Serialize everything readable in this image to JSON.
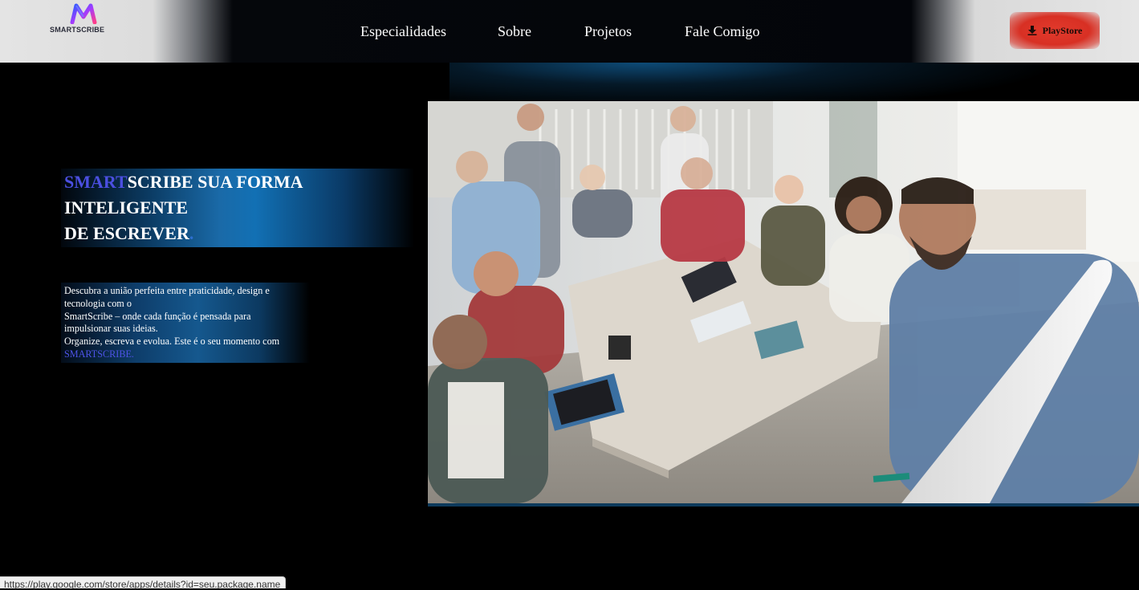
{
  "header": {
    "logo_text": "SMARTSCRIBE",
    "nav": [
      {
        "label": "Especialidades"
      },
      {
        "label": "Sobre"
      },
      {
        "label": "Projetos"
      },
      {
        "label": "Fale Comigo"
      }
    ],
    "playstore_button": {
      "label": "PlayStore",
      "icon": "download-icon"
    }
  },
  "hero": {
    "title_accent": "SMART",
    "title_line1_rest": "SCRIBE SUA FORMA",
    "title_line2": "INTELIGENTE",
    "title_line3": "DE ESCREVER",
    "title_dot": ".",
    "description": {
      "line1": "Descubra a união perfeita entre praticidade, design e",
      "line2": "tecnologia com o",
      "line3": "SmartScribe – onde cada função é pensada para",
      "line4": "impulsionar suas ideias.",
      "line5": "Organize, escreva e evolua. Este é o seu momento com",
      "brand": "SMARTSCRIBE."
    }
  },
  "status_bar": {
    "url": "https://play.google.com/store/apps/details?id=seu.package.name"
  },
  "colors": {
    "accent": "#4b4fe0",
    "playstore_button": "#d83024",
    "hero_glow": "#1270b4"
  }
}
